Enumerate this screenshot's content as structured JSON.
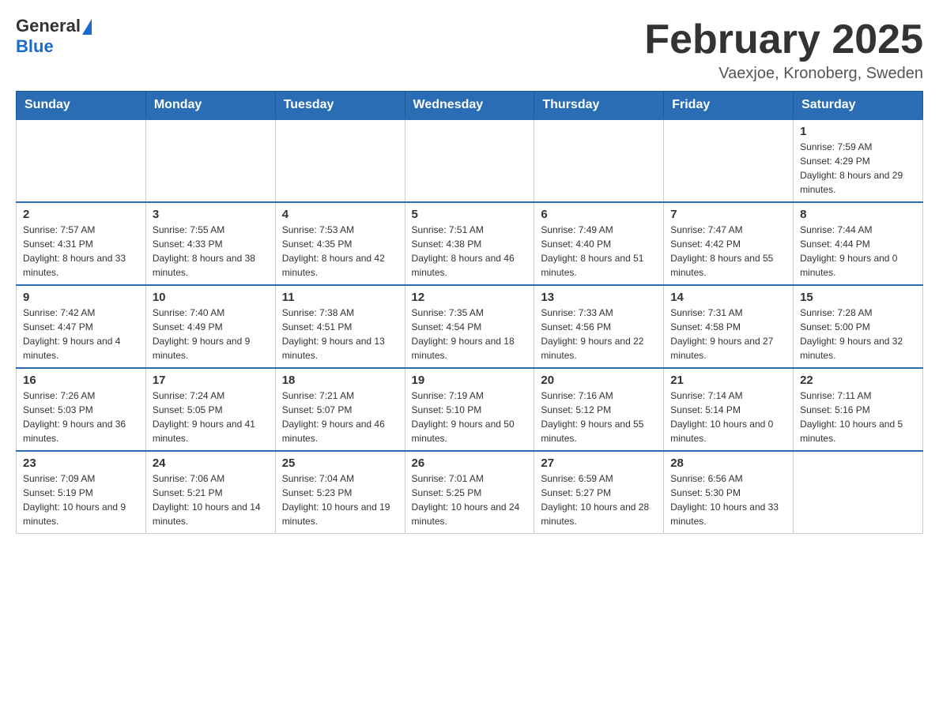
{
  "logo": {
    "general": "General",
    "blue": "Blue"
  },
  "header": {
    "title": "February 2025",
    "subtitle": "Vaexjoe, Kronoberg, Sweden"
  },
  "weekdays": [
    "Sunday",
    "Monday",
    "Tuesday",
    "Wednesday",
    "Thursday",
    "Friday",
    "Saturday"
  ],
  "weeks": [
    [
      {
        "day": "",
        "info": ""
      },
      {
        "day": "",
        "info": ""
      },
      {
        "day": "",
        "info": ""
      },
      {
        "day": "",
        "info": ""
      },
      {
        "day": "",
        "info": ""
      },
      {
        "day": "",
        "info": ""
      },
      {
        "day": "1",
        "info": "Sunrise: 7:59 AM\nSunset: 4:29 PM\nDaylight: 8 hours and 29 minutes."
      }
    ],
    [
      {
        "day": "2",
        "info": "Sunrise: 7:57 AM\nSunset: 4:31 PM\nDaylight: 8 hours and 33 minutes."
      },
      {
        "day": "3",
        "info": "Sunrise: 7:55 AM\nSunset: 4:33 PM\nDaylight: 8 hours and 38 minutes."
      },
      {
        "day": "4",
        "info": "Sunrise: 7:53 AM\nSunset: 4:35 PM\nDaylight: 8 hours and 42 minutes."
      },
      {
        "day": "5",
        "info": "Sunrise: 7:51 AM\nSunset: 4:38 PM\nDaylight: 8 hours and 46 minutes."
      },
      {
        "day": "6",
        "info": "Sunrise: 7:49 AM\nSunset: 4:40 PM\nDaylight: 8 hours and 51 minutes."
      },
      {
        "day": "7",
        "info": "Sunrise: 7:47 AM\nSunset: 4:42 PM\nDaylight: 8 hours and 55 minutes."
      },
      {
        "day": "8",
        "info": "Sunrise: 7:44 AM\nSunset: 4:44 PM\nDaylight: 9 hours and 0 minutes."
      }
    ],
    [
      {
        "day": "9",
        "info": "Sunrise: 7:42 AM\nSunset: 4:47 PM\nDaylight: 9 hours and 4 minutes."
      },
      {
        "day": "10",
        "info": "Sunrise: 7:40 AM\nSunset: 4:49 PM\nDaylight: 9 hours and 9 minutes."
      },
      {
        "day": "11",
        "info": "Sunrise: 7:38 AM\nSunset: 4:51 PM\nDaylight: 9 hours and 13 minutes."
      },
      {
        "day": "12",
        "info": "Sunrise: 7:35 AM\nSunset: 4:54 PM\nDaylight: 9 hours and 18 minutes."
      },
      {
        "day": "13",
        "info": "Sunrise: 7:33 AM\nSunset: 4:56 PM\nDaylight: 9 hours and 22 minutes."
      },
      {
        "day": "14",
        "info": "Sunrise: 7:31 AM\nSunset: 4:58 PM\nDaylight: 9 hours and 27 minutes."
      },
      {
        "day": "15",
        "info": "Sunrise: 7:28 AM\nSunset: 5:00 PM\nDaylight: 9 hours and 32 minutes."
      }
    ],
    [
      {
        "day": "16",
        "info": "Sunrise: 7:26 AM\nSunset: 5:03 PM\nDaylight: 9 hours and 36 minutes."
      },
      {
        "day": "17",
        "info": "Sunrise: 7:24 AM\nSunset: 5:05 PM\nDaylight: 9 hours and 41 minutes."
      },
      {
        "day": "18",
        "info": "Sunrise: 7:21 AM\nSunset: 5:07 PM\nDaylight: 9 hours and 46 minutes."
      },
      {
        "day": "19",
        "info": "Sunrise: 7:19 AM\nSunset: 5:10 PM\nDaylight: 9 hours and 50 minutes."
      },
      {
        "day": "20",
        "info": "Sunrise: 7:16 AM\nSunset: 5:12 PM\nDaylight: 9 hours and 55 minutes."
      },
      {
        "day": "21",
        "info": "Sunrise: 7:14 AM\nSunset: 5:14 PM\nDaylight: 10 hours and 0 minutes."
      },
      {
        "day": "22",
        "info": "Sunrise: 7:11 AM\nSunset: 5:16 PM\nDaylight: 10 hours and 5 minutes."
      }
    ],
    [
      {
        "day": "23",
        "info": "Sunrise: 7:09 AM\nSunset: 5:19 PM\nDaylight: 10 hours and 9 minutes."
      },
      {
        "day": "24",
        "info": "Sunrise: 7:06 AM\nSunset: 5:21 PM\nDaylight: 10 hours and 14 minutes."
      },
      {
        "day": "25",
        "info": "Sunrise: 7:04 AM\nSunset: 5:23 PM\nDaylight: 10 hours and 19 minutes."
      },
      {
        "day": "26",
        "info": "Sunrise: 7:01 AM\nSunset: 5:25 PM\nDaylight: 10 hours and 24 minutes."
      },
      {
        "day": "27",
        "info": "Sunrise: 6:59 AM\nSunset: 5:27 PM\nDaylight: 10 hours and 28 minutes."
      },
      {
        "day": "28",
        "info": "Sunrise: 6:56 AM\nSunset: 5:30 PM\nDaylight: 10 hours and 33 minutes."
      },
      {
        "day": "",
        "info": ""
      }
    ]
  ]
}
